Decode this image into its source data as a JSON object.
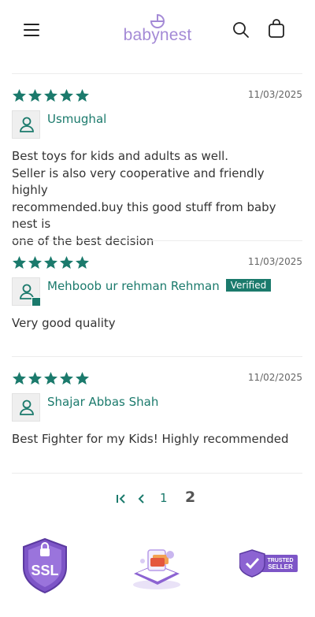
{
  "header": {
    "brand": "babynest",
    "menu_icon": "hamburger-menu-icon",
    "search_icon": "search-icon",
    "cart_icon": "cart-icon"
  },
  "colors": {
    "accent": "#1b7a6c",
    "brand": "#a48ad6"
  },
  "reviews": [
    {
      "rating": 5,
      "date": "11/03/2025",
      "author": "Usmughal",
      "verified": false,
      "body": [
        "Best toys for kids and adults as well.",
        "Seller is also very cooperative and friendly highly",
        "recommended.buy this good stuff from baby nest is",
        "one of the best decision"
      ]
    },
    {
      "rating": 5,
      "date": "11/03/2025",
      "author": "Mehboob ur rehman Rehman",
      "verified": true,
      "verified_label": "Verified",
      "body": [
        "Very good quality"
      ]
    },
    {
      "rating": 5,
      "date": "11/02/2025",
      "author": "Shajar Abbas Shah",
      "verified": false,
      "body": [
        "Best Fighter for my Kids! Highly recommended"
      ]
    }
  ],
  "pagination": {
    "pages": [
      "1",
      "2"
    ],
    "current": "2"
  },
  "badges": {
    "ssl_label": "SSL",
    "trusted_line1": "TRUSTED",
    "trusted_line2": "SELLER"
  }
}
